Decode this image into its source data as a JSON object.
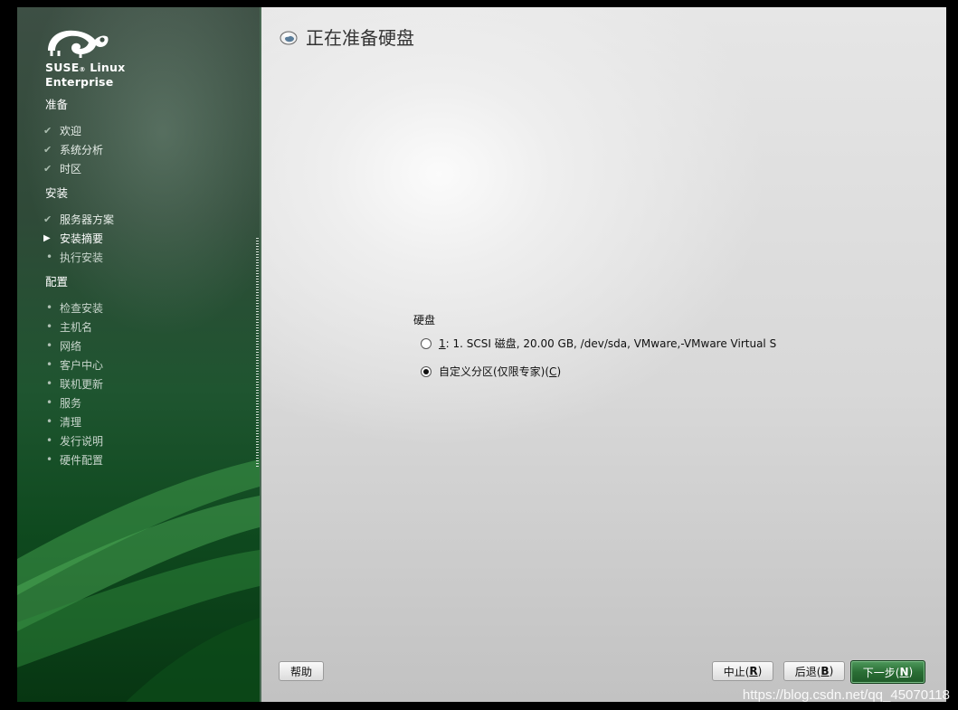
{
  "sidebar": {
    "brand_line1": "SUSE",
    "brand_line1b": "Linux",
    "brand_line2": "Enterprise",
    "sections": [
      {
        "title": "准备",
        "steps": [
          {
            "label": "欢迎",
            "state": "done"
          },
          {
            "label": "系统分析",
            "state": "done"
          },
          {
            "label": "时区",
            "state": "done"
          }
        ]
      },
      {
        "title": "安装",
        "steps": [
          {
            "label": "服务器方案",
            "state": "done"
          },
          {
            "label": "安装摘要",
            "state": "current"
          },
          {
            "label": "执行安装",
            "state": "todo"
          }
        ]
      },
      {
        "title": "配置",
        "steps": [
          {
            "label": "检查安装",
            "state": "todo"
          },
          {
            "label": "主机名",
            "state": "todo"
          },
          {
            "label": "网络",
            "state": "todo"
          },
          {
            "label": "客户中心",
            "state": "todo"
          },
          {
            "label": "联机更新",
            "state": "todo"
          },
          {
            "label": "服务",
            "state": "todo"
          },
          {
            "label": "清理",
            "state": "todo"
          },
          {
            "label": "发行说明",
            "state": "todo"
          },
          {
            "label": "硬件配置",
            "state": "todo"
          }
        ]
      }
    ],
    "icons": {
      "done": "check-icon",
      "current": "triangle-right-icon",
      "todo": "bullet-icon"
    }
  },
  "main": {
    "title": "正在准备硬盘",
    "title_icon": "disk-icon",
    "group_label": "硬盘",
    "options": [
      {
        "key": "1",
        "after_key": ":    1. SCSI 磁盘, 20.00 GB, /dev/sda, VMware,-VMware Virtual S",
        "checked": false
      },
      {
        "prefix": "自定义分区(仅限专家)(",
        "key": "C",
        "after_key": ")",
        "checked": true
      }
    ]
  },
  "buttons": {
    "help": "帮助",
    "abort_prefix": "中止(",
    "abort_key": "R",
    "abort_suffix": ")",
    "back_prefix": "后退(",
    "back_key": "B",
    "back_suffix": ")",
    "next_prefix": "下一步(",
    "next_key": "N",
    "next_suffix": ")"
  },
  "watermark": "https://blog.csdn.net/qq_45070118",
  "colors": {
    "accent_green": "#2a6e35",
    "sidebar_dark": "#073612"
  }
}
